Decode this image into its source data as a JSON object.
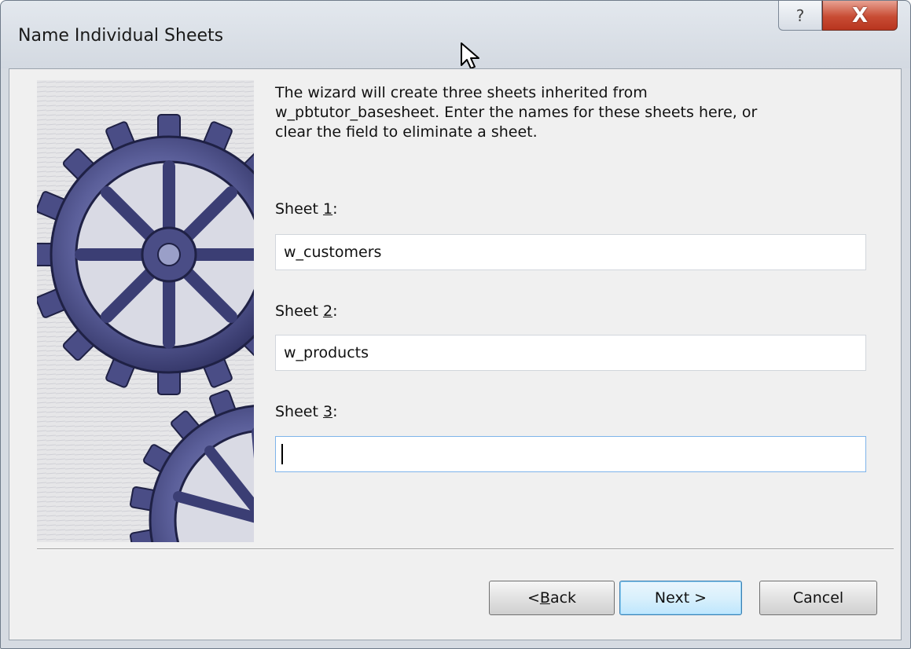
{
  "window": {
    "title": "Name Individual Sheets",
    "help_glyph": "?",
    "close_glyph": "X"
  },
  "wizard": {
    "instructions": "The wizard will create three sheets inherited from\nw_pbtutor_basesheet.  Enter the names for these sheets here, or\nclear the field to eliminate a sheet.",
    "sheets": [
      {
        "label_prefix": "Sheet ",
        "mnemonic": "1",
        "label_suffix": ":",
        "value": "w_customers"
      },
      {
        "label_prefix": "Sheet ",
        "mnemonic": "2",
        "label_suffix": ":",
        "value": "w_products"
      },
      {
        "label_prefix": "Sheet ",
        "mnemonic": "3",
        "label_suffix": ":",
        "value": ""
      }
    ]
  },
  "buttons": {
    "back_prefix": "< ",
    "back_mnemonic": "B",
    "back_rest": "ack",
    "next": "Next >",
    "cancel": "Cancel"
  },
  "icons": {
    "illustration": "gears-illustration",
    "help": "help-icon",
    "close": "close-icon",
    "cursor": "mouse-cursor-icon"
  },
  "colors": {
    "dialog_bg": "#f0f0f0",
    "close_red": "#c84c34",
    "gear_blue": "#5b5f9a",
    "default_button_border": "#3c7fb1"
  }
}
